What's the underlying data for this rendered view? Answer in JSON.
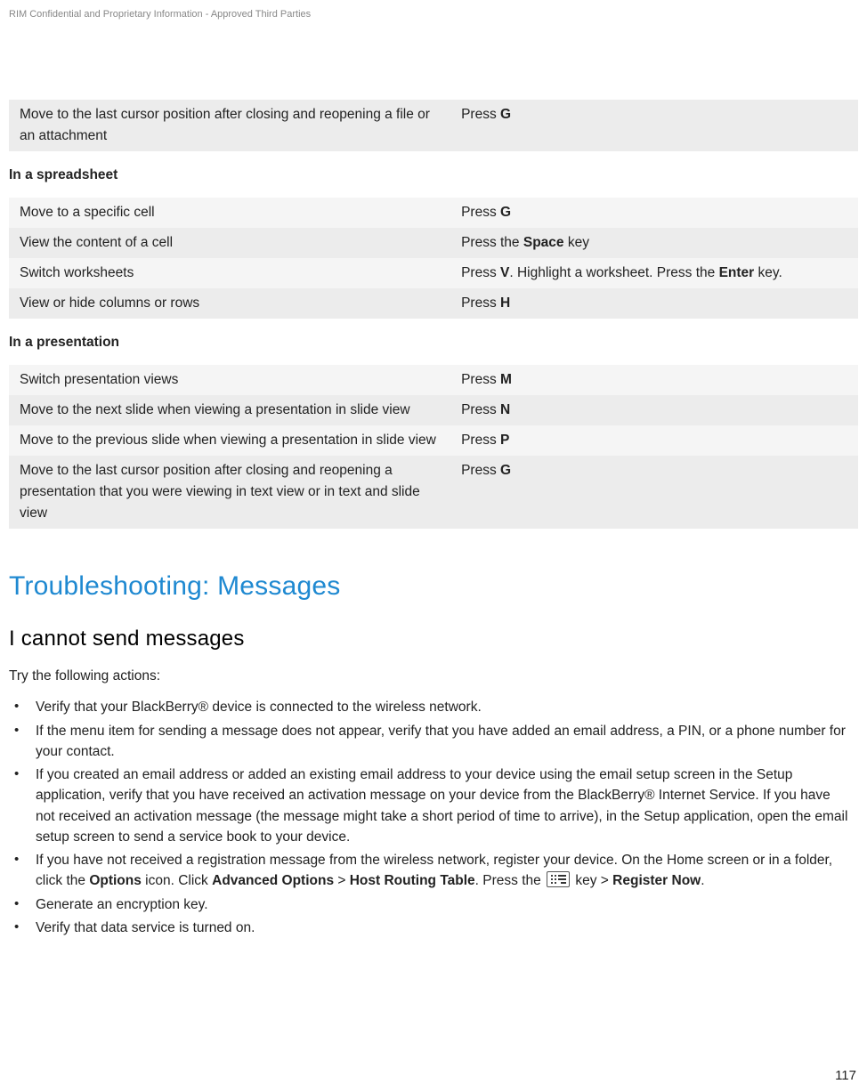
{
  "header": {
    "confidential": "RIM Confidential and Proprietary Information - Approved Third Parties"
  },
  "tables": {
    "top": {
      "rows": [
        {
          "action": "Move to the last cursor position after closing and reopening a file or an attachment",
          "key_pre": "Press ",
          "key_bold": "G",
          "key_post": ""
        }
      ]
    },
    "spreadsheet": {
      "label": "In a spreadsheet",
      "rows": [
        {
          "action": "Move to a specific cell",
          "key_pre": "Press ",
          "key_bold": "G",
          "key_post": ""
        },
        {
          "action": "View the content of a cell",
          "key_pre": "Press the ",
          "key_bold": "Space",
          "key_post": " key"
        },
        {
          "action": "Switch worksheets",
          "key_pre": "Press ",
          "key_bold": "V",
          "key_mid": ". Highlight a worksheet. Press the ",
          "key_bold2": "Enter",
          "key_post": " key."
        },
        {
          "action": "View or hide columns or rows",
          "key_pre": "Press ",
          "key_bold": "H",
          "key_post": ""
        }
      ]
    },
    "presentation": {
      "label": "In a presentation",
      "rows": [
        {
          "action": "Switch presentation views",
          "key_pre": "Press ",
          "key_bold": "M",
          "key_post": ""
        },
        {
          "action": "Move to the next slide when viewing a presentation in slide view",
          "key_pre": "Press ",
          "key_bold": "N",
          "key_post": ""
        },
        {
          "action": "Move to the previous slide when viewing a presentation in slide view",
          "key_pre": "Press ",
          "key_bold": "P",
          "key_post": ""
        },
        {
          "action": "Move to the last cursor position after closing and reopening a presentation that you were viewing in text view or in text and slide view",
          "key_pre": "Press ",
          "key_bold": "G",
          "key_post": ""
        }
      ]
    }
  },
  "troubleshoot": {
    "heading": "Troubleshooting: Messages",
    "issue_heading": "I cannot send messages",
    "try_line": "Try the following actions:",
    "bullets": {
      "b1": "Verify that your BlackBerry® device is connected to the wireless network.",
      "b2": "If the menu item for sending a message does not appear, verify that you have added an email address, a PIN, or a phone number for your contact.",
      "b3": "If you created an email address or added an existing email address to your device using the email setup screen in the Setup application, verify that you have received an activation message on your device from the BlackBerry® Internet Service. If you have not received an activation message (the message might take a short period of time to arrive), in the Setup application, open the email setup screen to send a service book to your device.",
      "b4_pre": "If you have not received a registration message from the wireless network, register your device. On the Home screen or in a folder, click the ",
      "b4_options": "Options",
      "b4_mid1": " icon. Click ",
      "b4_adv": "Advanced Options",
      "b4_gt1": " > ",
      "b4_hrt": "Host Routing Table",
      "b4_mid2": ". Press the ",
      "b4_mid3": " key > ",
      "b4_register": "Register Now",
      "b4_end": ".",
      "b5": "Generate an encryption key.",
      "b6": "Verify that data service is turned on."
    }
  },
  "page_number": "117"
}
